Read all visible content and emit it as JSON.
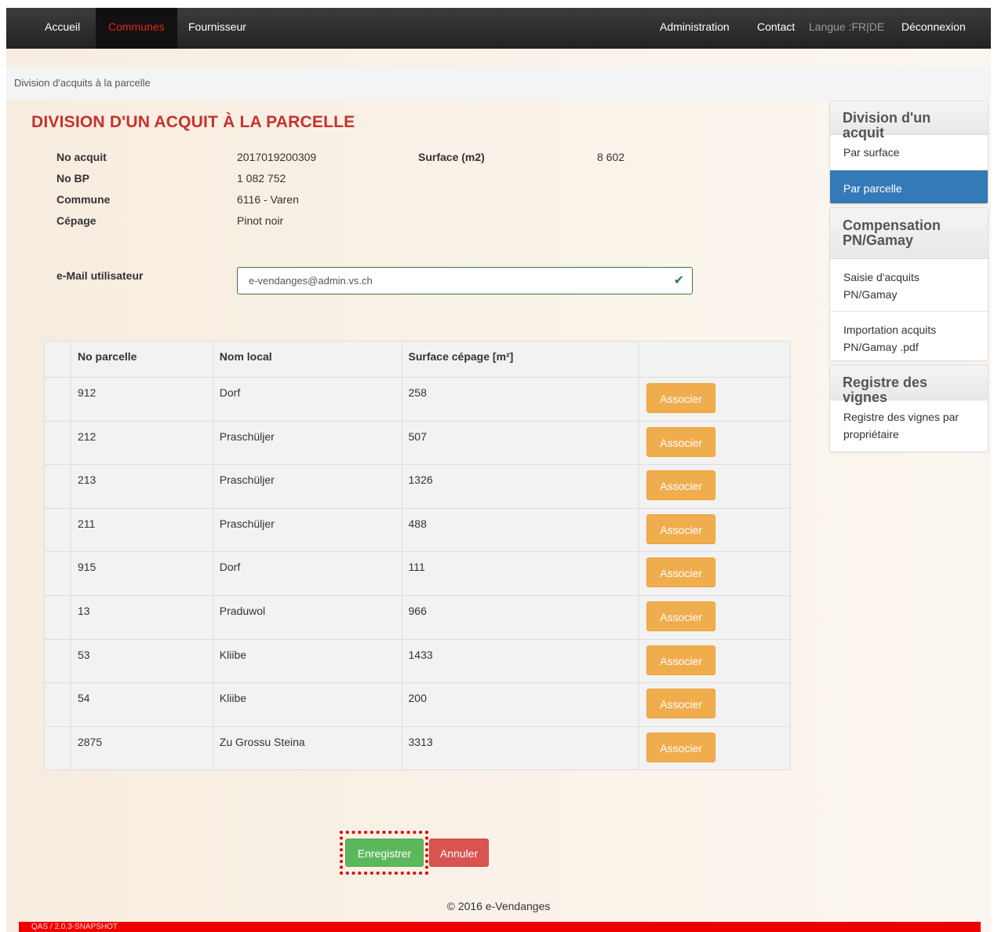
{
  "nav": {
    "accueil": "Accueil",
    "communes": "Communes",
    "fournisseur": "Fournisseur",
    "administration": "Administration",
    "contact": "Contact",
    "langue": "Langue :FR|DE",
    "deconnexion": "Déconnexion"
  },
  "breadcrumb": "Division d'acquits à la parcelle",
  "page_title": "DIVISION D'UN ACQUIT À LA PARCELLE",
  "info": {
    "no_acquit_label": "No acquit",
    "no_acquit": "2017019200309",
    "surface_label": "Surface (m2)",
    "surface": "8 602",
    "no_bp_label": "No BP",
    "no_bp": "1 082 752",
    "commune_label": "Commune",
    "commune": "6116 - Varen",
    "cepage_label": "Cépage",
    "cepage": "Pinot noir",
    "email_label": "e-Mail utilisateur",
    "email_value": "e-vendanges@admin.vs.ch"
  },
  "table": {
    "headers": [
      "No parcelle",
      "Nom local",
      "Surface cépage [m²]"
    ],
    "button_label": "Associer",
    "rows": [
      {
        "no": "912",
        "nom": "Dorf",
        "surface": "258"
      },
      {
        "no": "212",
        "nom": "Praschüljer",
        "surface": "507"
      },
      {
        "no": "213",
        "nom": "Praschüljer",
        "surface": "1326"
      },
      {
        "no": "211",
        "nom": "Praschüljer",
        "surface": "488"
      },
      {
        "no": "915",
        "nom": "Dorf",
        "surface": "111"
      },
      {
        "no": "13",
        "nom": "Praduwol",
        "surface": "966"
      },
      {
        "no": "53",
        "nom": "Kliibe",
        "surface": "1433"
      },
      {
        "no": "54",
        "nom": "Kliibe",
        "surface": "200"
      },
      {
        "no": "2875",
        "nom": "Zu Grossu Steina",
        "surface": "3313"
      }
    ]
  },
  "actions": {
    "save": "Enregistrer",
    "cancel": "Annuler"
  },
  "footer": "© 2016 e-Vendanges",
  "version": "QAS / 2.0.3-SNAPSHOT",
  "sidebar": {
    "division_head": "Division d'un acquit",
    "par_surface": "Par surface",
    "par_parcelle": "Par parcelle",
    "compensation_head": "Compensation PN/Gamay",
    "saisie": "Saisie d'acquits PN/Gamay",
    "importation": "Importation acquits PN/Gamay .pdf",
    "registre_head": "Registre des vignes",
    "registre_item": "Registre des vignes par propriétaire"
  },
  "colors": {
    "title_red": "#c9302c",
    "associer_orange": "#f0ad4e",
    "save_green": "#5cb85c",
    "cancel_red": "#d9534f",
    "active_blue": "#337ab7"
  }
}
